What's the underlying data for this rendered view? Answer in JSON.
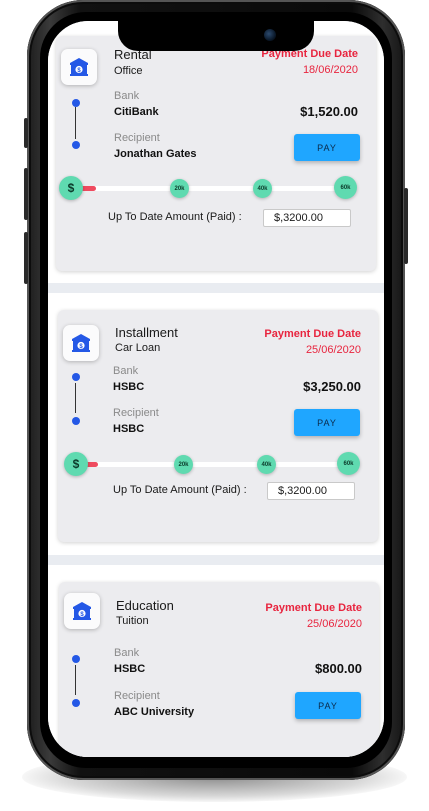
{
  "colors": {
    "accent_blue": "#2458e6",
    "pay_button": "#1fa6ff",
    "due_red": "#e8253f",
    "progress_red": "#ef4b5f",
    "milestone_green": "#5fdab0",
    "card_bg": "#ececef"
  },
  "labels": {
    "due": "Payment Due Date",
    "bank": "Bank",
    "recipient": "Recipient",
    "pay": "PAY",
    "paid": "Up To Date Amount (Paid) :"
  },
  "cards": [
    {
      "icon": "bank-icon",
      "title": "Rental",
      "subtitle": "Office",
      "due_date": "18/06/2020",
      "bank": "CitiBank",
      "amount": "$1,520.00",
      "recipient": "Jonathan Gates",
      "progress": 0.09,
      "milestones": [
        "$",
        "20k",
        "40k",
        "60k"
      ],
      "paid_value": "$,3200.00"
    },
    {
      "icon": "bank-icon",
      "title": "Installment",
      "subtitle": "Car Loan",
      "due_date": "25/06/2020",
      "bank": "HSBC",
      "amount": "$3,250.00",
      "recipient": "HSBC",
      "progress": 0.09,
      "milestones": [
        "$",
        "20k",
        "40k",
        "60k"
      ],
      "paid_value": "$,3200.00"
    },
    {
      "icon": "bank-icon",
      "title": "Education",
      "subtitle": "Tuition",
      "due_date": "25/06/2020",
      "bank": "HSBC",
      "amount": "$800.00",
      "recipient": "ABC University"
    }
  ]
}
